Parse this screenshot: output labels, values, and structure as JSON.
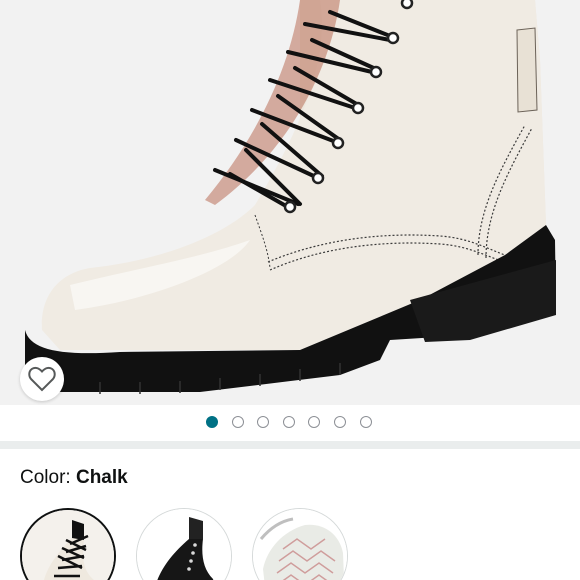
{
  "product": {
    "gallery": {
      "image": "white-leather-lace-up-combat-boot",
      "dots_total": 7,
      "active_index": 0
    },
    "wishlist_icon": "heart-outline-icon",
    "color": {
      "label": "Color:",
      "selected_value": "Chalk"
    },
    "swatches": [
      {
        "name": "chalk-boot-swatch",
        "selected": true
      },
      {
        "name": "black-boot-swatch",
        "selected": false
      },
      {
        "name": "white-sole-swatch",
        "selected": false
      }
    ]
  },
  "colors": {
    "accent": "#007185",
    "boot_body": "#f0ebe3",
    "sole": "#111111",
    "background": "#f2f2f2"
  }
}
